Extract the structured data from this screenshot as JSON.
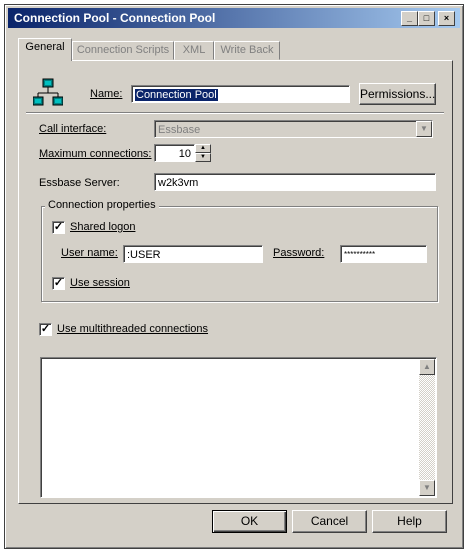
{
  "window": {
    "title": "Connection Pool - Connection Pool",
    "controls": {
      "minimize": "_",
      "maximize": "□",
      "close": "×"
    }
  },
  "tabs": [
    {
      "label": "General",
      "active": true
    },
    {
      "label": "Connection Scripts",
      "active": false
    },
    {
      "label": "XML",
      "active": false
    },
    {
      "label": "Write Back",
      "active": false
    }
  ],
  "general": {
    "name_label": "Name:",
    "name_value": "Connection Pool",
    "permissions_button": "Permissions...",
    "call_interface_label": "Call interface:",
    "call_interface_value": "Essbase",
    "max_connections_label": "Maximum connections:",
    "max_connections_value": "10",
    "essbase_server_label": "Essbase Server:",
    "essbase_server_value": "w2k3vm",
    "connection_properties": {
      "legend": "Connection properties",
      "shared_logon_label": "Shared logon",
      "shared_logon_checked": true,
      "user_name_label": "User name:",
      "user_name_value": ":USER",
      "password_label": "Password:",
      "password_value": "**********",
      "use_session_label": "Use session",
      "use_session_checked": true
    },
    "multithreaded_label": "Use multithreaded connections",
    "multithreaded_checked": true,
    "description_text": ""
  },
  "footer": {
    "ok": "OK",
    "cancel": "Cancel",
    "help": "Help"
  },
  "icons": {
    "connection_pool": "network-computers-icon",
    "check": "checkmark-icon"
  }
}
